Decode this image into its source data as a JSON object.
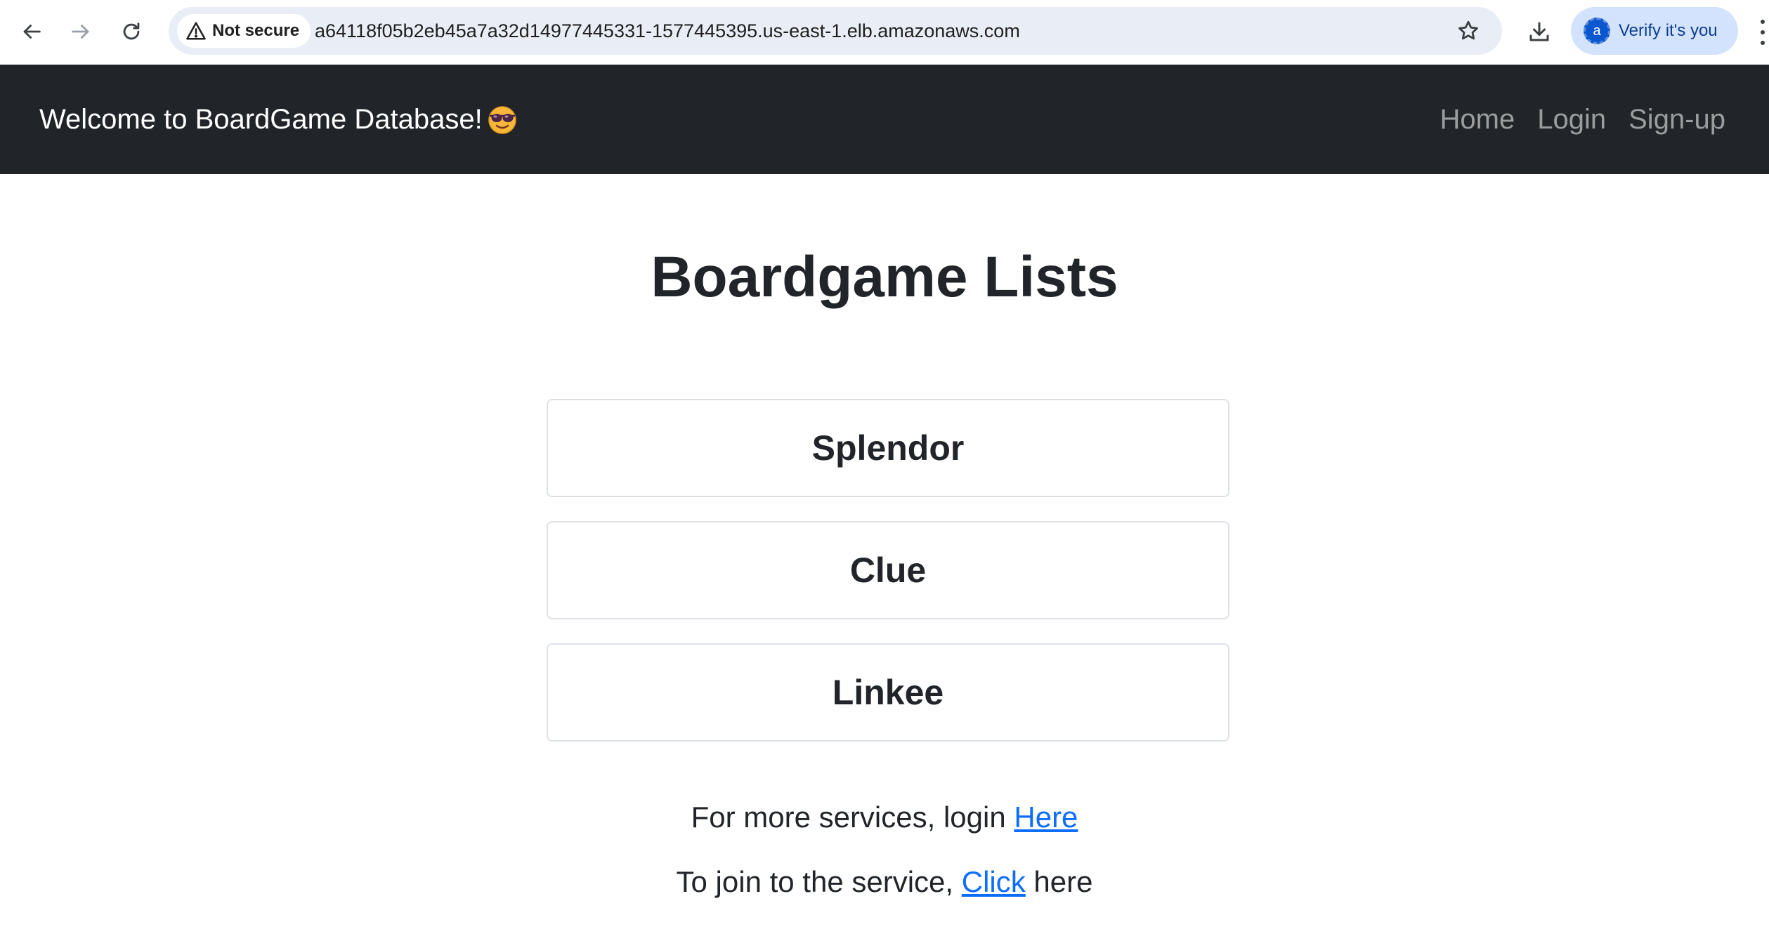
{
  "browser": {
    "security_label": "Not secure",
    "url": "a64118f05b2eb45a7a32d14977445331-1577445395.us-east-1.elb.amazonaws.com",
    "verify_label": "Verify it's you",
    "avatar_letter": "a"
  },
  "navbar": {
    "brand": "Welcome to BoardGame Database!",
    "brand_icon": "sunglasses-emoji-icon",
    "links": [
      "Home",
      "Login",
      "Sign-up"
    ],
    "background": "#212529"
  },
  "main": {
    "title": "Boardgame Lists",
    "games": [
      "Splendor",
      "Clue",
      "Linkee"
    ],
    "login_line": {
      "prefix": "For more services, login ",
      "link": "Here"
    },
    "join_line": {
      "prefix": "To join to the service, ",
      "link": "Click",
      "suffix": " here"
    }
  },
  "colors": {
    "link": "#0d6efd",
    "text": "#212529"
  }
}
